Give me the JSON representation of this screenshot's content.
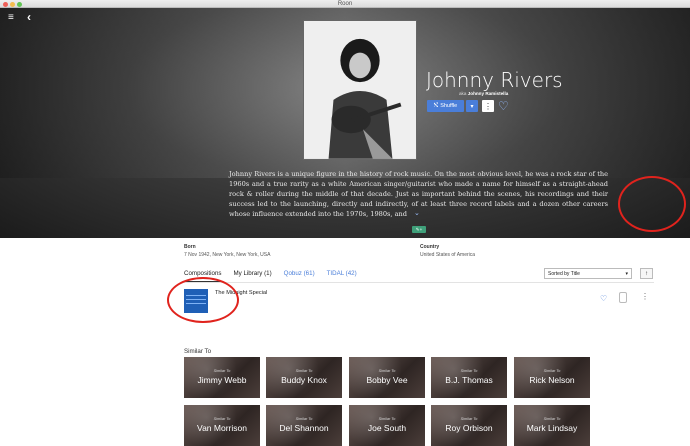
{
  "window": {
    "title": "Roon"
  },
  "hero": {
    "artist_name": "Johnny Rivers",
    "aka_prefix": "aka",
    "aka_name": "Johnny Ramistella",
    "shuffle_label": "Shuffle",
    "bio": "Johnny Rivers is a unique figure in the history of rock music. On the most obvious level, he was a rock star of the 1960s and a true rarity as a white American singer/guitarist who made a name for himself as a straight-ahead rock & roller during the middle of that decade. Just as important behind the scenes, his recordings and their success led to the launching, directly and indirectly, of at least three record labels and a dozen other careers whose influence extended into the 1970s, 1980s, and"
  },
  "info": {
    "born_label": "Born",
    "born_value": "7 Nov 1942, New York, New York, USA",
    "country_label": "Country",
    "country_value": "United States of America"
  },
  "tabs": [
    {
      "label": "Compositions"
    },
    {
      "label": "My Library (1)"
    },
    {
      "label": "Qobuz (61)"
    },
    {
      "label": "TIDAL (42)"
    }
  ],
  "sort": {
    "label": "Sorted by Title"
  },
  "album": {
    "title": "The Midnight Special"
  },
  "similar": {
    "heading": "Similar To",
    "card_prefix": "Similar To",
    "artists": [
      "Jimmy Webb",
      "Buddy Knox",
      "Bobby Vee",
      "B.J. Thomas",
      "Rick Nelson",
      "Van Morrison",
      "Del Shannon",
      "Joe South",
      "Roy Orbison",
      "Mark Lindsay"
    ]
  },
  "colors": {
    "accent": "#4a7ed9",
    "annotation": "#e0231d"
  },
  "icons": [
    "menu-icon",
    "back-icon",
    "shuffle-icon",
    "chevron-down-icon",
    "more-vertical-icon",
    "heart-icon",
    "lock-icon",
    "sort-direction-icon"
  ]
}
